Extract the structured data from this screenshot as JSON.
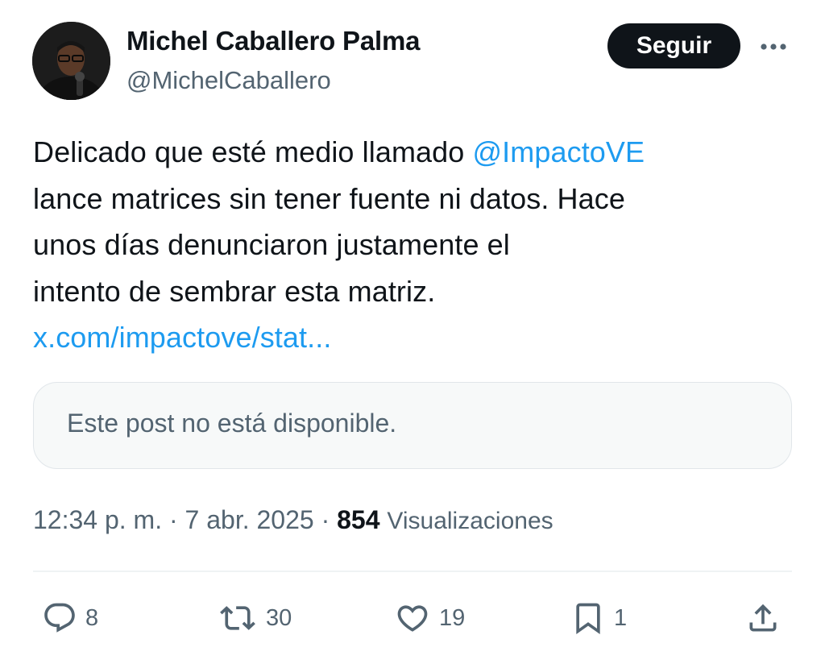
{
  "author": {
    "display_name": "Michel Caballero Palma",
    "handle": "@MichelCaballero",
    "avatar_icon": "profile-photo"
  },
  "follow_label": "Seguir",
  "more_icon": "more-horizontal-icon",
  "tweet": {
    "line1_text": "Delicado que esté medio llamado",
    "mention": "@ImpactoVE",
    "line2": "lance matrices sin tener fuente ni datos. Hace",
    "line3": "unos días denunciaron justamente el",
    "line4": "intento de sembrar esta matriz.",
    "link": "x.com/impactove/stat..."
  },
  "quoted_post": {
    "message": "Este post no está disponible."
  },
  "meta": {
    "time": "12:34 p. m.",
    "date": "7 abr. 2025",
    "views_count": "854",
    "views_label": "Visualizaciones"
  },
  "actions": {
    "replies": "8",
    "reposts": "30",
    "likes": "19",
    "bookmarks": "1"
  },
  "colors": {
    "text": "#0f1419",
    "secondary": "#536471",
    "link": "#1d9bf0",
    "button_bg": "#0f1419",
    "card_bg": "#f7f9f9"
  }
}
